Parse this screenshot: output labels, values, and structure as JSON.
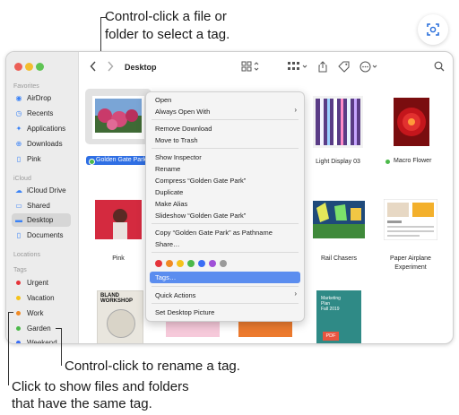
{
  "callouts": {
    "top_line1": "Control-click a file or",
    "top_line2": "folder to select a tag.",
    "rename": "Control-click to rename a tag.",
    "bottom_line1": "Click to show files and folders",
    "bottom_line2": "that have the same tag."
  },
  "toolbar": {
    "title": "Desktop",
    "back_icon": "chevron-left-icon",
    "forward_icon": "chevron-right-icon"
  },
  "sidebar": {
    "favorites_header": "Favorites",
    "favorites": [
      {
        "label": "AirDrop",
        "icon": "airdrop-icon"
      },
      {
        "label": "Recents",
        "icon": "clock-icon"
      },
      {
        "label": "Applications",
        "icon": "applications-icon"
      },
      {
        "label": "Downloads",
        "icon": "download-icon"
      },
      {
        "label": "Pink",
        "icon": "document-icon"
      }
    ],
    "icloud_header": "iCloud",
    "icloud": [
      {
        "label": "iCloud Drive",
        "icon": "cloud-icon"
      },
      {
        "label": "Shared",
        "icon": "shared-folder-icon"
      },
      {
        "label": "Desktop",
        "icon": "desktop-icon"
      },
      {
        "label": "Documents",
        "icon": "document-icon"
      }
    ],
    "locations_header": "Locations",
    "tags_header": "Tags",
    "tags": [
      {
        "label": "Urgent",
        "color": "#e5343a"
      },
      {
        "label": "Vacation",
        "color": "#f5c21b"
      },
      {
        "label": "Work",
        "color": "#f08a24"
      },
      {
        "label": "Garden",
        "color": "#4cb94a"
      },
      {
        "label": "Weekend",
        "color": "#3b6ef5"
      }
    ]
  },
  "files": {
    "golden_gate": "Golden Gate Park",
    "light_display": "Light Display 03",
    "macro_flower": "Macro Flower",
    "pink": "Pink",
    "rail_chasers": "Rail Chasers",
    "paper_airplane_1": "Paper Airplane",
    "paper_airplane_2": "Experiment",
    "bland_1": "BLAND",
    "bland_2": "WORKSHOP",
    "marketing_1": "Marketing",
    "marketing_2": "Plan",
    "marketing_3": "Fall 2019",
    "pdf": "PDF"
  },
  "menu": {
    "open": "Open",
    "always_open_with": "Always Open With",
    "remove_download": "Remove Download",
    "move_to_trash": "Move to Trash",
    "show_inspector": "Show Inspector",
    "rename": "Rename",
    "compress": "Compress “Golden Gate Park”",
    "duplicate": "Duplicate",
    "make_alias": "Make Alias",
    "slideshow": "Slideshow “Golden Gate Park”",
    "copy_pathname": "Copy “Golden Gate Park” as Pathname",
    "share": "Share…",
    "tag_colors": [
      "#e5343a",
      "#f08a24",
      "#f5c21b",
      "#4cb94a",
      "#3b6ef5",
      "#a050d8",
      "#9a9a9a"
    ],
    "tags": "Tags…",
    "quick_actions": "Quick Actions",
    "set_desktop_picture": "Set Desktop Picture",
    "highlight_color": "#5b8def"
  }
}
